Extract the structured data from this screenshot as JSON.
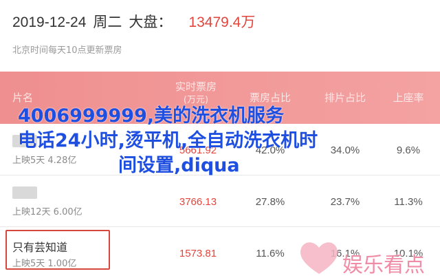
{
  "header": {
    "date": "2019-12-24",
    "weekday": "周二",
    "dapan_label": "大盘：",
    "total": "13479.4万",
    "subtitle": "北京时间每天10点更新票房"
  },
  "table": {
    "columns": {
      "name": "片名",
      "box_line1": "实时票房",
      "box_line2": "(万元)",
      "box_pct": "票房占比",
      "show_pct": "排片占比",
      "seat_pct": "上座率"
    },
    "rows": [
      {
        "title": "",
        "days": "上映5天  4.28亿",
        "box": "5661.92",
        "box_pct": "42.0%",
        "show_pct": "34.0%",
        "seat_pct": "9.6%"
      },
      {
        "title": "",
        "days": "上映12天  6.00亿",
        "box": "3766.13",
        "box_pct": "27.8%",
        "show_pct": "23.7%",
        "seat_pct": "11.3%"
      },
      {
        "title": "只有芸知道",
        "days": "上映5天  1.00亿",
        "box": "1573.81",
        "box_pct": "11.6%",
        "show_pct": "16.1%",
        "seat_pct": "10.1%"
      }
    ]
  },
  "watermark": {
    "line1": "4006999999,美的洗衣机服务",
    "line2": "电话24小时,烫平机,全自动洗衣机时",
    "line3": "间设置,diqua"
  },
  "brand": {
    "text": "娱乐看点",
    "color": "#f08ca6"
  },
  "colors": {
    "accent": "#e2453c",
    "header_bg": "#f19595",
    "watermark": "#1e4fe0"
  }
}
